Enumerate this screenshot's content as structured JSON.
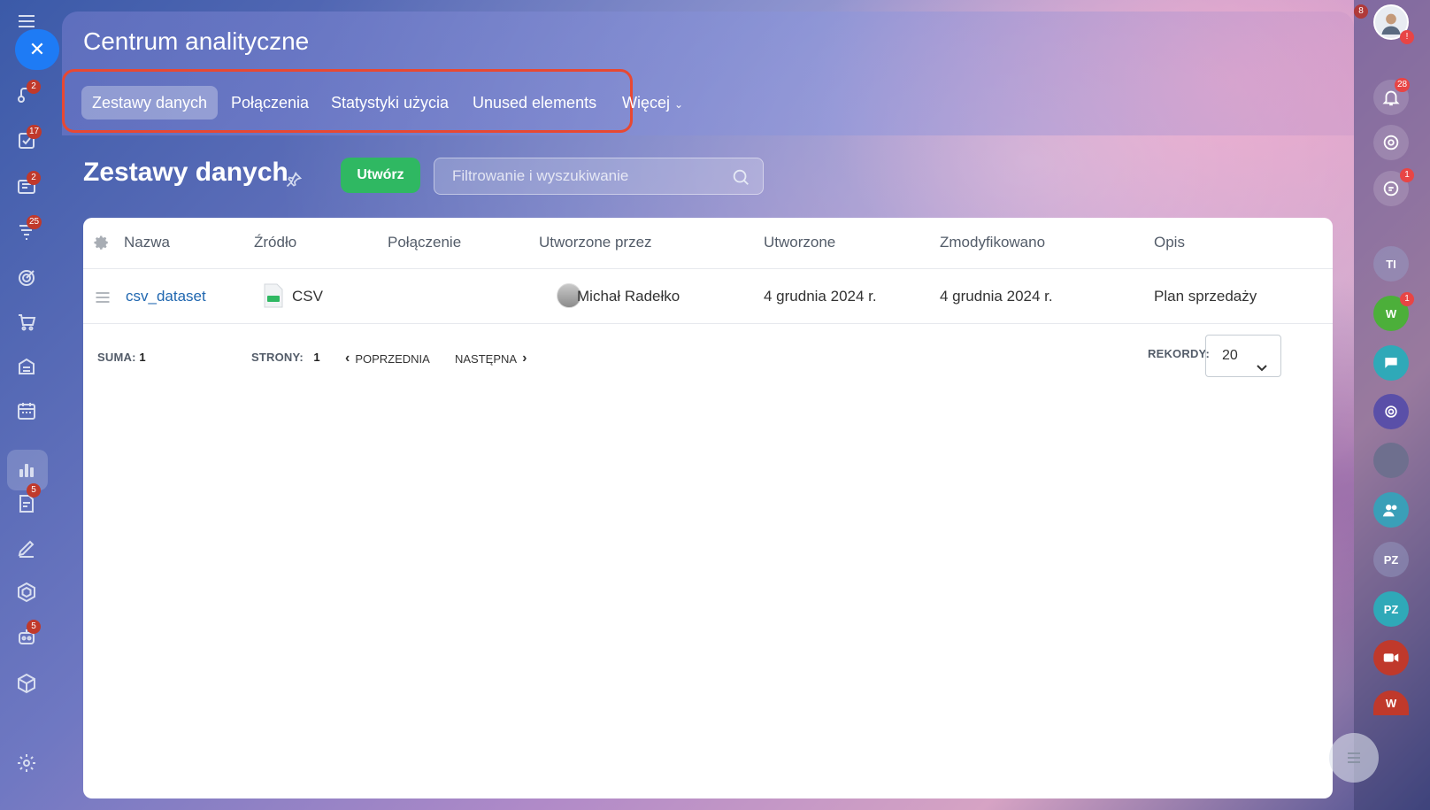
{
  "app": {
    "title": "Centrum analityczne",
    "tabs": [
      {
        "label": "Zestawy danych",
        "active": true
      },
      {
        "label": "Połączenia"
      },
      {
        "label": "Statystyki użycia"
      },
      {
        "label": "Unused elements"
      }
    ],
    "more_label": "Więcej"
  },
  "page": {
    "title": "Zestawy danych",
    "create_label": "Utwórz",
    "search_placeholder": "Filtrowanie i wyszukiwanie"
  },
  "table": {
    "columns": [
      "Nazwa",
      "Źródło",
      "Połączenie",
      "Utworzone przez",
      "Utworzone",
      "Zmodyfikowano",
      "Opis"
    ],
    "rows": [
      {
        "name": "csv_dataset",
        "source": "CSV",
        "connection": "",
        "created_by": "Michał Radełko",
        "created": "4 grudnia 2024 r.",
        "modified": "4 grudnia 2024 r.",
        "description": "Plan sprzedaży"
      }
    ]
  },
  "footer": {
    "total_label": "SUMA:",
    "total_value": "1",
    "pages_label": "STRONY:",
    "pages_value": "1",
    "prev_label": "POPRZEDNIA",
    "next_label": "NASTĘPNA",
    "records_label": "REKORDY:",
    "records_value": "20"
  },
  "left_sidebar": {
    "badges": {
      "crm": "2",
      "tasks": "17",
      "feed": "2",
      "sales": "25",
      "docs": "5",
      "robots": "5"
    }
  },
  "right_sidebar": {
    "notifications_badge": "28",
    "chat_badge": "1",
    "user_w_badge": "1",
    "top_badge": "8",
    "avatar_initials": [
      "TI",
      "W",
      "PZ",
      "PZ",
      "W"
    ]
  },
  "colors": {
    "accent_blue": "#1e7bf5",
    "create_green": "#2fb862",
    "highlight_red": "#e84832",
    "link_blue": "#2067b0"
  }
}
